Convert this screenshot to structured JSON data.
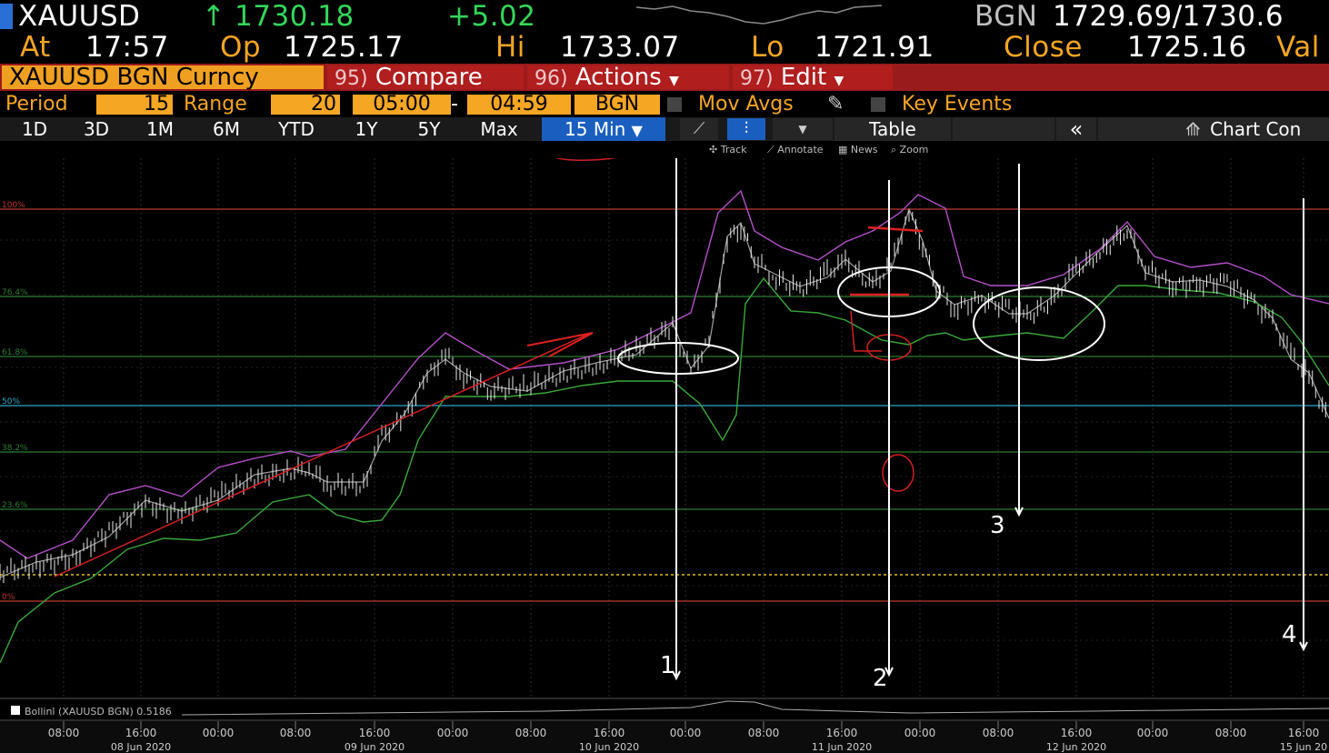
{
  "header": {
    "ticker": "XAUUSD",
    "arrow": "↑",
    "last": "1730.18",
    "change": "+5.02",
    "source": "BGN",
    "bid_ask": "1729.69/1730.6",
    "at_label": "At",
    "time": "17:57",
    "op_label": "Op",
    "open": "1725.17",
    "hi_label": "Hi",
    "high": "1733.07",
    "lo_label": "Lo",
    "low": "1721.91",
    "close_label": "Close",
    "close": "1725.16",
    "val_label": "Val"
  },
  "menubar": {
    "security": "XAUUSD BGN Curncy",
    "compare_num": "95)",
    "compare": "Compare",
    "actions_num": "96)",
    "actions": "Actions",
    "edit_num": "97)",
    "edit": "Edit"
  },
  "settings": {
    "period_label": "Period",
    "period_value": "15",
    "range_label": "Range",
    "range_value": "20",
    "time_from": "05:00",
    "dash": "-",
    "time_to": "04:59",
    "source": "BGN",
    "mov_avgs": "Mov Avgs",
    "key_events": "Key Events"
  },
  "toolbar": {
    "ranges": [
      "1D",
      "3D",
      "1M",
      "6M",
      "YTD",
      "1Y",
      "5Y",
      "Max"
    ],
    "interval": "15 Min",
    "table": "Table",
    "collapse": "«",
    "chart_con": "Chart Con"
  },
  "chart_tools": [
    "Track",
    "Annotate",
    "News",
    "Zoom"
  ],
  "fib_labels": [
    "100%",
    "76.4%",
    "61.8%",
    "50%",
    "38.2%",
    "23.6%",
    "0%"
  ],
  "annotations": [
    "1",
    "2",
    "3",
    "4"
  ],
  "indicator_label": "Bollinl (XAUUSD BGN) 0.5186",
  "time_axis": {
    "hours": [
      "08:00",
      "16:00",
      "00:00",
      "08:00",
      "16:00",
      "00:00",
      "08:00",
      "16:00",
      "00:00",
      "08:00",
      "16:00",
      "00:00",
      "08:00",
      "16:00",
      "00:00",
      "08:00",
      "16:00"
    ],
    "dates": [
      "08 Jun 2020",
      "09 Jun 2020",
      "10 Jun 2020",
      "11 Jun 2020",
      "12 Jun 2020",
      "15 Jun 20"
    ]
  },
  "colors": {
    "amber": "#f5a623",
    "green": "#33d65a",
    "red_bar": "#9a1b1b",
    "selected_tab": "#1a5fbf",
    "fib_red": "#c0392b",
    "fib_green": "#2e7d32",
    "fib_cyan": "#2aa7c9",
    "upper_band": "#b450c8",
    "lower_band": "#3aa83a"
  }
}
